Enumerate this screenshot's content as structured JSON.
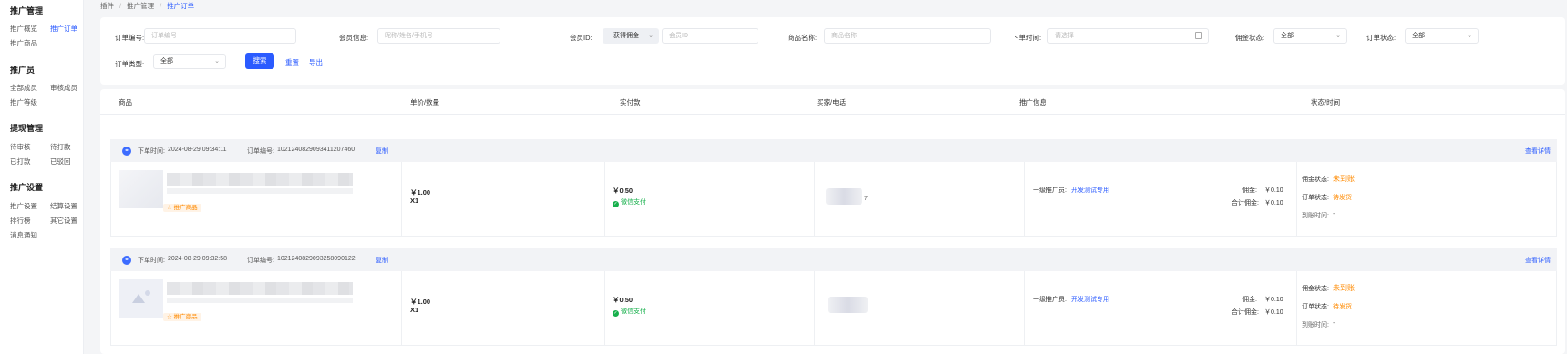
{
  "sidebar": {
    "groups": [
      {
        "title": "推广管理",
        "items": [
          "推广概览",
          "推广订单",
          "推广商品"
        ]
      },
      {
        "title": "推广员",
        "items": [
          "全部成员",
          "审核成员",
          "推广等级"
        ]
      },
      {
        "title": "提现管理",
        "items": [
          "待审核",
          "待打款",
          "已打款",
          "已驳回"
        ]
      },
      {
        "title": "推广设置",
        "items": [
          "推广设置",
          "结算设置",
          "排行榜",
          "其它设置",
          "消息通知"
        ]
      }
    ],
    "active": "推广订单"
  },
  "breadcrumb": [
    "插件",
    "推广管理",
    "推广订单"
  ],
  "filters": {
    "order_no_label": "订单编号:",
    "order_no_placeholder": "订单编号",
    "member_info_label": "会员信息:",
    "member_info_placeholder": "昵称/姓名/手机号",
    "member_id_label": "会员ID:",
    "member_id_select": "获得佣金",
    "member_id_placeholder": "会员ID",
    "goods_name_label": "商品名称:",
    "goods_name_placeholder": "商品名称",
    "order_time_label": "下单时间:",
    "order_time_placeholder": "请选择",
    "commission_status_label": "佣金状态:",
    "commission_status_value": "全部",
    "order_status_label": "订单状态:",
    "order_status_value": "全部",
    "order_type_label": "订单类型:",
    "order_type_value": "全部",
    "search_button": "搜索",
    "reset_button": "重置",
    "export_button": "导出"
  },
  "table": {
    "columns": [
      "商品",
      "单价/数量",
      "实付款",
      "买家/电话",
      "推广信息",
      "状态/时间"
    ],
    "orders": [
      {
        "time_label": "下单时间:",
        "time": "2024-08-29 09:34:11",
        "order_no_label": "订单编号:",
        "order_no": "1021240829093411207460",
        "copy": "复制",
        "detail": "查看详情",
        "tag": "推广商品",
        "price": "￥1.00",
        "qty": "X1",
        "paid": "￥0.50",
        "pay_method": "微信支付",
        "buyer_fragment": "7",
        "promoter_label": "一级推广员:",
        "promoter": "开发测试专用",
        "commission_label": "佣金:",
        "commission": "￥0.10",
        "total_commission_label": "合计佣金:",
        "total_commission": "￥0.10",
        "commission_status_label": "佣金状态:",
        "commission_status": "未到账",
        "order_status_label": "订单状态:",
        "order_status": "待发货",
        "arrive_time_label": "到账时间:",
        "arrive_time": "-"
      },
      {
        "time_label": "下单时间:",
        "time": "2024-08-29 09:32:58",
        "order_no_label": "订单编号:",
        "order_no": "1021240829093258090122",
        "copy": "复制",
        "detail": "查看详情",
        "tag": "推广商品",
        "price": "￥1.00",
        "qty": "X1",
        "paid": "￥0.50",
        "pay_method": "微信支付",
        "buyer_fragment": "",
        "promoter_label": "一级推广员:",
        "promoter": "开发测试专用",
        "commission_label": "佣金:",
        "commission": "￥0.10",
        "total_commission_label": "合计佣金:",
        "total_commission": "￥0.10",
        "commission_status_label": "佣金状态:",
        "commission_status": "未到账",
        "order_status_label": "订单状态:",
        "order_status": "待发货",
        "arrive_time_label": "到账时间:",
        "arrive_time": "-"
      }
    ]
  }
}
